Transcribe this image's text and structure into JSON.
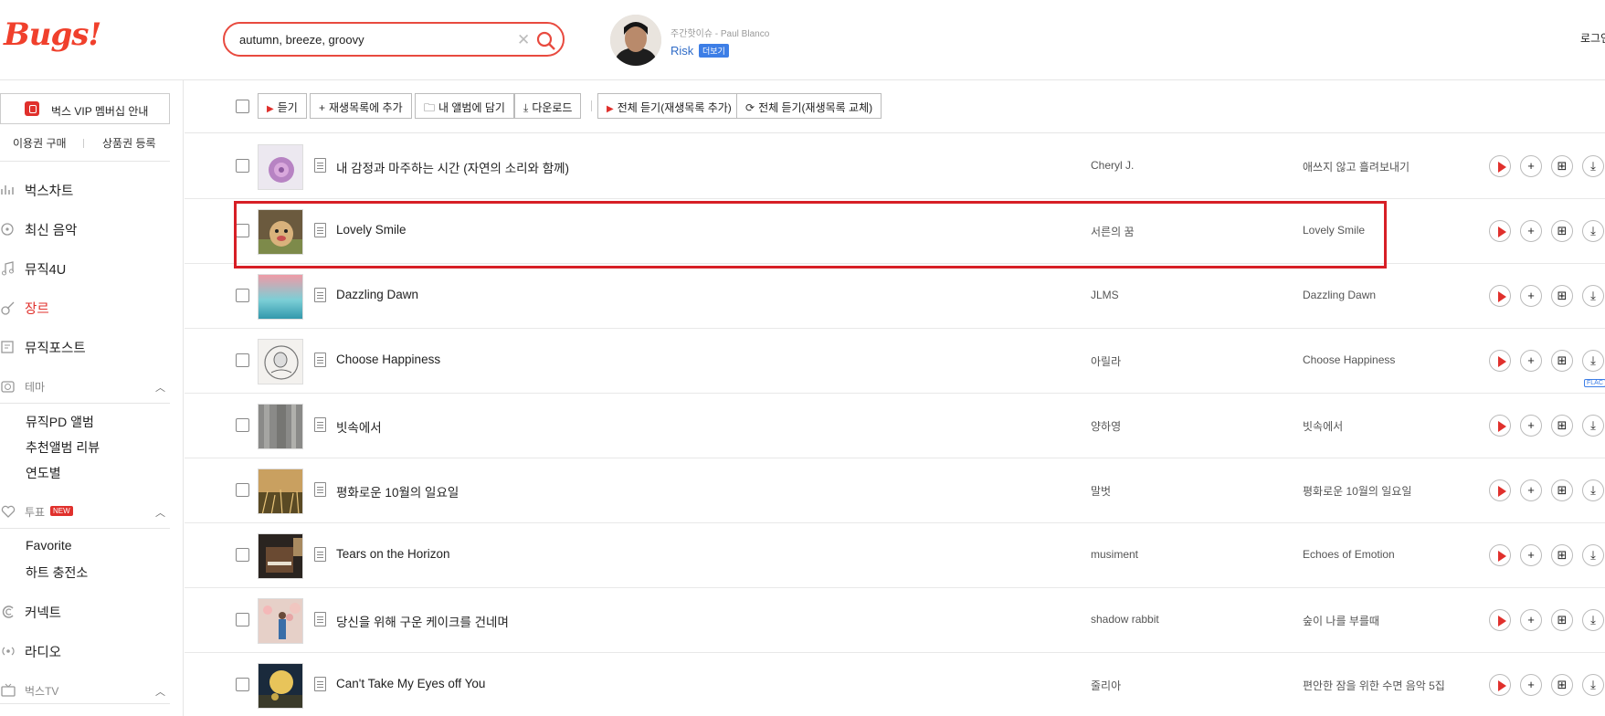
{
  "header": {
    "logo": "Bugs!",
    "search": {
      "value": "autumn, breeze, groovy"
    },
    "news": {
      "subtitle": "주간핫이슈 - Paul Blanco",
      "title": "Risk",
      "badge": "더보기"
    },
    "login": "로그인"
  },
  "sidebar": {
    "vip": "벅스 VIP 멤버십 안내",
    "buy_ticket": "이용권 구매",
    "register": "상품권 등록",
    "menu": [
      {
        "label": "벅스차트",
        "icon": "chart-icon"
      },
      {
        "label": "최신 음악",
        "icon": "disc-icon"
      },
      {
        "label": "뮤직4U",
        "icon": "note-icon"
      },
      {
        "label": "장르",
        "icon": "guitar-icon"
      },
      {
        "label": "뮤직포스트",
        "icon": "post-icon"
      }
    ],
    "theme": {
      "label": "테마",
      "items": [
        "뮤직PD 앨범",
        "추천앨범 리뷰",
        "연도별"
      ]
    },
    "vote": {
      "label": "투표",
      "badge": "NEW",
      "items": [
        "Favorite",
        "하트 충전소"
      ]
    },
    "connect": "커넥트",
    "radio": "라디오",
    "tv": "벅스TV"
  },
  "toolbar": {
    "listen": "듣기",
    "add_playlist": "재생목록에 추가",
    "add_album": "내 앨범에 담기",
    "download": "다운로드",
    "play_all_add": "전체 듣기(재생목록 추가)",
    "play_all_replace": "전체 듣기(재생목록 교체)"
  },
  "tracks": [
    {
      "title": "내 감정과 마주하는 시간 (자연의 소리와 함께)",
      "artist": "Cheryl J.",
      "album": "애쓰지 않고 흘려보내기"
    },
    {
      "title": "Lovely Smile",
      "artist": "서른의 꿈",
      "album": "Lovely Smile"
    },
    {
      "title": "Dazzling Dawn",
      "artist": "JLMS",
      "album": "Dazzling Dawn"
    },
    {
      "title": "Choose Happiness",
      "artist": "아릴라",
      "album": "Choose Happiness"
    },
    {
      "title": "빗속에서",
      "artist": "양하영",
      "album": "빗속에서"
    },
    {
      "title": "평화로운 10월의 일요일",
      "artist": "말벗",
      "album": "평화로운 10월의 일요일"
    },
    {
      "title": "Tears on the Horizon",
      "artist": "musiment",
      "album": "Echoes of Emotion"
    },
    {
      "title": "당신을 위해 구운 케이크를 건네며",
      "artist": "shadow rabbit",
      "album": "숲이 나를 부를때"
    },
    {
      "title": "Can't Take My Eyes off You",
      "artist": "줄리아",
      "album": "편안한 잠을 위한 수면 음악 5집"
    }
  ],
  "flac_label": "FLAC",
  "colors": {
    "accent": "#e0302c",
    "highlight": "#d71f26",
    "link": "#2f6bc7"
  }
}
